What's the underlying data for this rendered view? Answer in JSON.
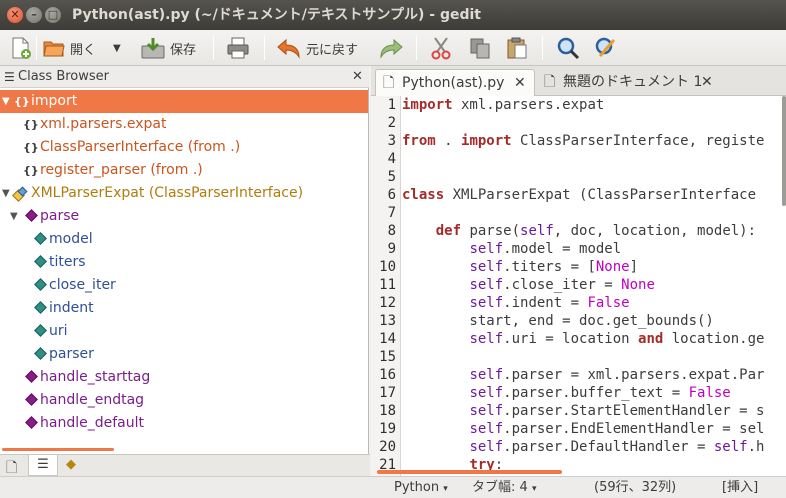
{
  "window": {
    "title": "Python(ast).py (~/ドキュメント/テキストサンプル) - gedit"
  },
  "toolbar": {
    "open_label": "開く",
    "save_label": "保存",
    "undo_label": "元に戻す"
  },
  "sidebar": {
    "title": "Class Browser",
    "items": [
      {
        "label": "import"
      },
      {
        "label": "xml.parsers.expat"
      },
      {
        "label": "ClassParserInterface (from .)"
      },
      {
        "label": "register_parser (from .)"
      },
      {
        "label": "XMLParserExpat (ClassParserInterface)"
      },
      {
        "label": "parse"
      },
      {
        "label": "model"
      },
      {
        "label": "titers"
      },
      {
        "label": "close_iter"
      },
      {
        "label": "indent"
      },
      {
        "label": "uri"
      },
      {
        "label": "parser"
      },
      {
        "label": "handle_starttag"
      },
      {
        "label": "handle_endtag"
      },
      {
        "label": "handle_default"
      }
    ]
  },
  "tabs": [
    {
      "label": "Python(ast).py"
    },
    {
      "label": "無題のドキュメント 1"
    }
  ],
  "editor": {
    "line_numbers": [
      "1",
      "2",
      "3",
      "4",
      "5",
      "6",
      "7",
      "8",
      "9",
      "10",
      "11",
      "12",
      "13",
      "14",
      "15",
      "16",
      "17",
      "18",
      "19",
      "20",
      "21"
    ],
    "lines": [
      "import xml.parsers.expat",
      "",
      "from . import ClassParserInterface, registe",
      "",
      "",
      "class XMLParserExpat (ClassParserInterface",
      "",
      "    def parse(self, doc, location, model):",
      "        self.model = model",
      "        self.titers = [None]",
      "        self.close_iter = None",
      "        self.indent = False",
      "        start, end = doc.get_bounds()",
      "        self.uri = location and location.ge",
      "",
      "        self.parser = xml.parsers.expat.Par",
      "        self.parser.buffer_text = False",
      "        self.parser.StartElementHandler = s",
      "        self.parser.EndElementHandler = sel",
      "        self.parser.DefaultHandler = self.h",
      "        try:"
    ]
  },
  "statusbar": {
    "language": "Python",
    "tab_width": "タブ幅: 4",
    "position": "(59行、32列)",
    "mode": "[挿入]"
  },
  "colors": {
    "accent": "#f07746",
    "titlebar": "#3c3b37"
  }
}
